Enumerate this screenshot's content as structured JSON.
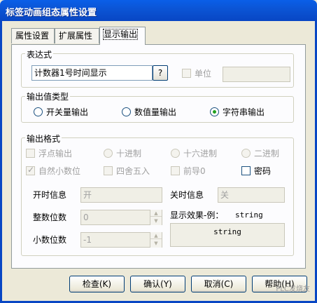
{
  "window": {
    "title": "标签动画组态属性设置"
  },
  "tabs": [
    {
      "label": "属性设置"
    },
    {
      "label": "扩展属性"
    },
    {
      "label": "显示输出"
    }
  ],
  "expression": {
    "group_label": "表达式",
    "value": "计数器1号时间显示",
    "browse_label": "?",
    "unit_label": "单位",
    "unit_value": ""
  },
  "output_type": {
    "group_label": "输出值类型",
    "options": [
      {
        "label": "开关量输出",
        "selected": false
      },
      {
        "label": "数值量输出",
        "selected": false
      },
      {
        "label": "字符串输出",
        "selected": true
      }
    ]
  },
  "output_format": {
    "group_label": "输出格式",
    "float_output": "浮点输出",
    "decimal": "十进制",
    "hexadecimal": "十六进制",
    "binary": "二进制",
    "natural_decimal": "自然小数位",
    "rounding": "四舍五入",
    "leading_zero": "前导0",
    "password": "密码",
    "on_label": "开时信息",
    "on_value": "开",
    "off_label": "关时信息",
    "off_value": "关",
    "integer_digits_label": "整数位数",
    "integer_digits_value": "0",
    "decimal_digits_label": "小数位数",
    "decimal_digits_value": "-1",
    "preview_label": "显示效果-例：",
    "preview_example": "string",
    "preview_value": "string"
  },
  "buttons": {
    "check": "检查(K)",
    "ok": "确认(Y)",
    "cancel": "取消(C)",
    "help": "帮助(H)"
  },
  "watermark": "PLC发烧友"
}
